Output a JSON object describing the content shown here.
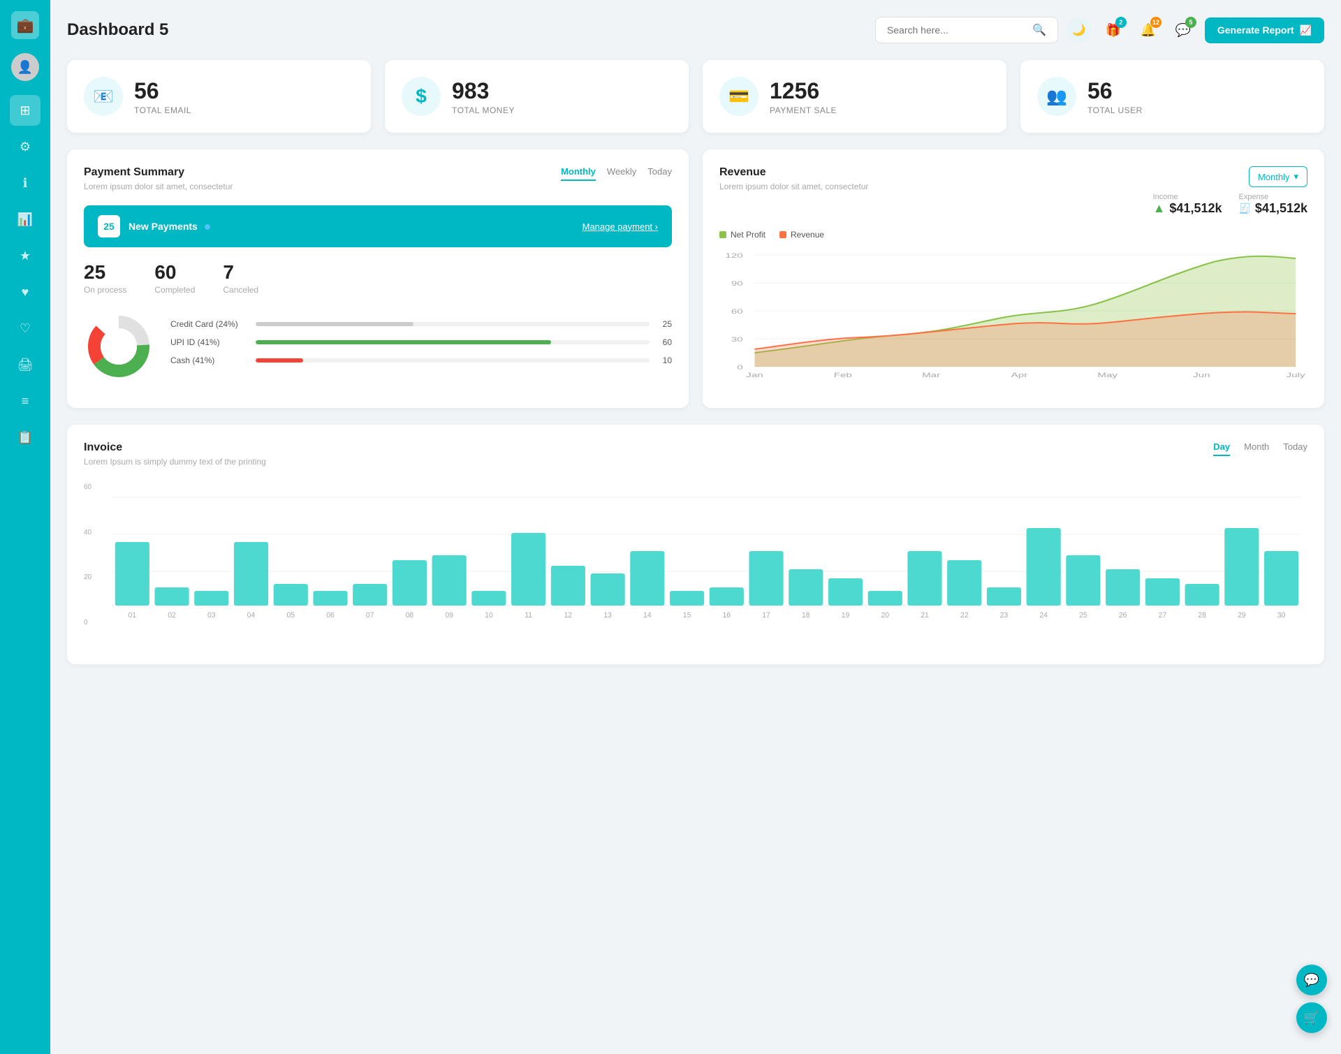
{
  "sidebar": {
    "logo_icon": "💼",
    "items": [
      {
        "id": "home",
        "icon": "⊞",
        "active": true
      },
      {
        "id": "settings",
        "icon": "⚙"
      },
      {
        "id": "info",
        "icon": "ℹ"
      },
      {
        "id": "chart",
        "icon": "📊"
      },
      {
        "id": "star",
        "icon": "★"
      },
      {
        "id": "heart",
        "icon": "♥"
      },
      {
        "id": "heart2",
        "icon": "♡"
      },
      {
        "id": "print",
        "icon": "🖨"
      },
      {
        "id": "menu",
        "icon": "≡"
      },
      {
        "id": "list",
        "icon": "📋"
      }
    ]
  },
  "header": {
    "title": "Dashboard 5",
    "search_placeholder": "Search here...",
    "dark_mode_icon": "🌙",
    "gift_badge": "2",
    "bell_badge": "12",
    "chat_badge": "5",
    "generate_btn": "Generate Report"
  },
  "stats": [
    {
      "id": "email",
      "number": "56",
      "label": "TOTAL EMAIL",
      "icon": "📧"
    },
    {
      "id": "money",
      "number": "983",
      "label": "TOTAL MONEY",
      "icon": "$"
    },
    {
      "id": "payment",
      "number": "1256",
      "label": "PAYMENT SALE",
      "icon": "💳"
    },
    {
      "id": "user",
      "number": "56",
      "label": "TOTAL USER",
      "icon": "👥"
    }
  ],
  "payment_summary": {
    "title": "Payment Summary",
    "subtitle": "Lorem ipsum dolor sit amet, consectetur",
    "tabs": [
      "Monthly",
      "Weekly",
      "Today"
    ],
    "active_tab": "Monthly",
    "new_payments_count": "25",
    "new_payments_label": "New Payments",
    "manage_link": "Manage payment",
    "on_process_count": "25",
    "on_process_label": "On process",
    "completed_count": "60",
    "completed_label": "Completed",
    "canceled_count": "7",
    "canceled_label": "Canceled",
    "progress_items": [
      {
        "label": "Credit Card (24%)",
        "percent": 40,
        "color": "#ccc",
        "value": "25"
      },
      {
        "label": "UPI ID (41%)",
        "percent": 75,
        "color": "#4caf50",
        "value": "60"
      },
      {
        "label": "Cash (41%)",
        "percent": 12,
        "color": "#f44336",
        "value": "10"
      }
    ]
  },
  "revenue": {
    "title": "Revenue",
    "subtitle": "Lorem ipsum dolor sit amet, consectetur",
    "dropdown": "Monthly",
    "income_label": "Income",
    "income_value": "$41,512k",
    "expense_label": "Expense",
    "expense_value": "$41,512k",
    "legend": [
      {
        "label": "Net Profit",
        "color": "#8bc34a"
      },
      {
        "label": "Revenue",
        "color": "#ff7043"
      }
    ],
    "x_labels": [
      "Jan",
      "Feb",
      "Mar",
      "Apr",
      "May",
      "Jun",
      "July"
    ],
    "y_labels": [
      "0",
      "30",
      "60",
      "90",
      "120"
    ]
  },
  "invoice": {
    "title": "Invoice",
    "subtitle": "Lorem Ipsum is simply dummy text of the printing",
    "tabs": [
      "Day",
      "Month",
      "Today"
    ],
    "active_tab": "Day",
    "x_labels": [
      "01",
      "02",
      "03",
      "04",
      "05",
      "06",
      "07",
      "08",
      "09",
      "10",
      "11",
      "12",
      "13",
      "14",
      "15",
      "16",
      "17",
      "18",
      "19",
      "20",
      "21",
      "22",
      "23",
      "24",
      "25",
      "26",
      "27",
      "28",
      "29",
      "30"
    ],
    "y_labels": [
      "0",
      "20",
      "40",
      "60"
    ],
    "bars": [
      35,
      10,
      8,
      35,
      12,
      8,
      12,
      25,
      28,
      8,
      40,
      22,
      18,
      30,
      8,
      10,
      30,
      20,
      15,
      8,
      30,
      25,
      10,
      43,
      28,
      20,
      15,
      12,
      43,
      30
    ]
  },
  "floating_buttons": [
    {
      "id": "chat",
      "icon": "💬"
    },
    {
      "id": "cart",
      "icon": "🛒"
    }
  ]
}
